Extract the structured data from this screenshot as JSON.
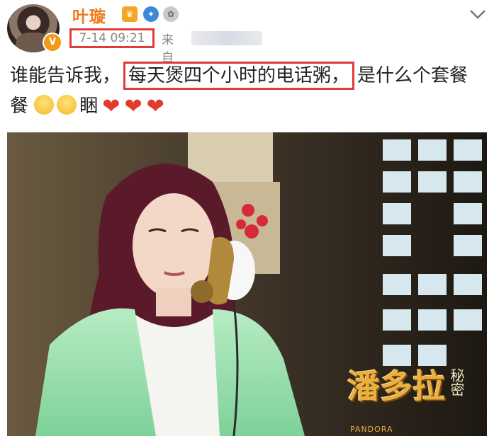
{
  "post": {
    "author": "叶璇",
    "timestamp": "7-14 09:21",
    "source_label": "来自",
    "text_before": "谁能告诉我，",
    "text_highlight": "每天煲四个小时的电话粥，",
    "text_after": "是什么个套餐",
    "text_end": "睏",
    "verified_badge": "V"
  },
  "photo": {
    "watermark_title": "潘多拉",
    "watermark_side": "秘密",
    "watermark_sub": "PANDORA"
  },
  "colors": {
    "username": "#f07a1c",
    "highlight_border": "#e13a3a",
    "heart": "#e33a2c",
    "meta_text": "#888888"
  },
  "icons": [
    "crown-badge-icon",
    "compass-badge-icon",
    "medal-badge-icon",
    "chevron-down-icon",
    "scared-emoji-icon",
    "sleepy-emoji-icon",
    "heart-icon"
  ]
}
